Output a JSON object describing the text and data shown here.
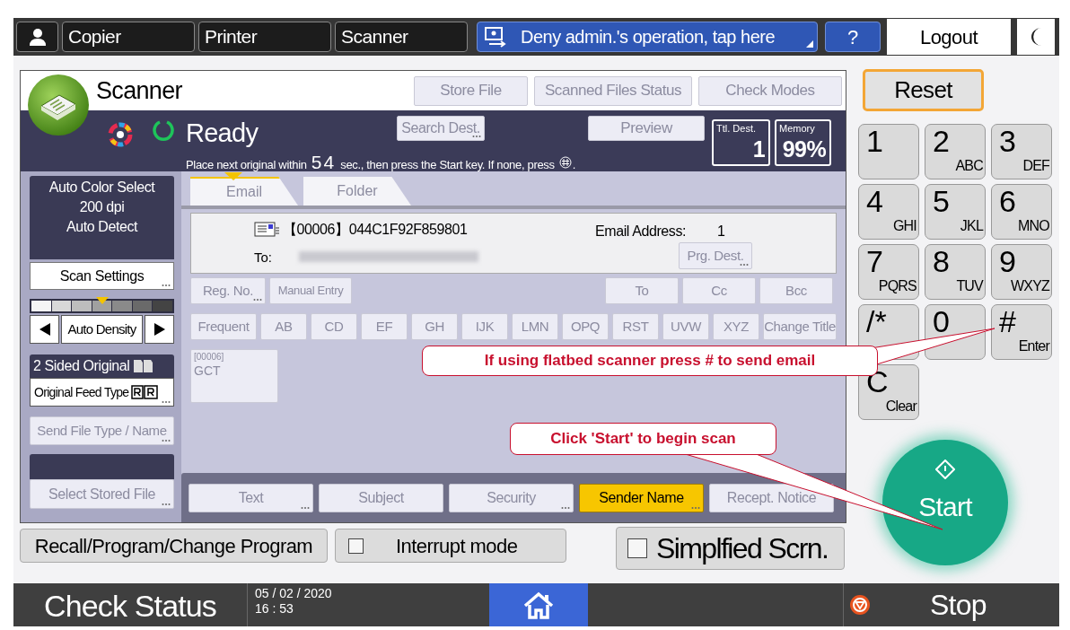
{
  "top_bar": {
    "apps": [
      {
        "label": "Copier",
        "selected": false
      },
      {
        "label": "Printer",
        "selected": false
      },
      {
        "label": "Scanner",
        "selected": false
      }
    ],
    "notice": "Deny admin.'s operation, tap here",
    "help": "?",
    "logout": "Logout"
  },
  "app": {
    "title": "Scanner",
    "header_buttons": [
      {
        "label": "Store File",
        "disabled": true
      },
      {
        "label": "Scanned Files Status",
        "disabled": true
      },
      {
        "label": "Check Modes",
        "disabled": true
      }
    ]
  },
  "status": {
    "text": "Ready",
    "message_before": "Place next original within",
    "seconds": "54",
    "message_after": "sec., then press the Start key. If none, press",
    "message_end": ".",
    "search_dest": {
      "label": "Search Dest.",
      "disabled": true
    },
    "preview": {
      "label": "Preview",
      "disabled": true
    },
    "total_dest": {
      "label": "Ttl. Dest.",
      "value": "1"
    },
    "memory": {
      "label": "Memory",
      "value": "99%"
    }
  },
  "settings_summary": [
    "Auto Color Select",
    "200 dpi",
    "Auto Detect"
  ],
  "scan_settings": "Scan Settings",
  "density": {
    "label": "Auto Density",
    "level": 0.5
  },
  "two_sided": "2 Sided Original",
  "feed_type": "Original Feed Type",
  "send_file_type": {
    "label": "Send File Type / Name",
    "disabled": true
  },
  "select_stored_file": {
    "label": "Select Stored File",
    "disabled": true
  },
  "tabs": [
    {
      "label": "Email",
      "selected": true
    },
    {
      "label": "Folder",
      "selected": false
    }
  ],
  "destination": {
    "entry": "【00006】044C1F92F859801",
    "to_label": "To:",
    "count_label": "Email Address:",
    "count": "1",
    "prg_dest": {
      "label": "Prg. Dest.",
      "disabled": true
    }
  },
  "dest_buttons": [
    {
      "label": "Reg. No.",
      "disabled": true
    },
    {
      "label": "Manual Entry",
      "disabled": true
    },
    {
      "label": "To",
      "disabled": true
    },
    {
      "label": "Cc",
      "disabled": true
    },
    {
      "label": "Bcc",
      "disabled": true
    }
  ],
  "index_buttons": [
    {
      "label": "Frequent",
      "disabled": true
    },
    {
      "label": "AB",
      "disabled": true
    },
    {
      "label": "CD",
      "disabled": true
    },
    {
      "label": "EF",
      "disabled": true
    },
    {
      "label": "GH",
      "disabled": true
    },
    {
      "label": "IJK",
      "disabled": true
    },
    {
      "label": "LMN",
      "disabled": true
    },
    {
      "label": "OPQ",
      "disabled": true
    },
    {
      "label": "RST",
      "disabled": true
    },
    {
      "label": "UVW",
      "disabled": true
    },
    {
      "label": "XYZ",
      "disabled": true
    },
    {
      "label": "Change Title",
      "disabled": true
    }
  ],
  "dest_tiles": [
    {
      "id": "[00006]",
      "name": "GCT",
      "disabled": true
    }
  ],
  "field_buttons": [
    {
      "label": "Text",
      "selected": false,
      "disabled": true
    },
    {
      "label": "Subject",
      "selected": false,
      "disabled": true
    },
    {
      "label": "Security",
      "selected": false,
      "disabled": true
    },
    {
      "label": "Sender Name",
      "selected": true,
      "disabled": false
    },
    {
      "label": "Recept. Notice",
      "selected": false,
      "disabled": true
    }
  ],
  "recall": "Recall/Program/Change Program",
  "interrupt": {
    "label": "Interrupt mode",
    "checked": false
  },
  "simplified": {
    "label": "Simplfied Scrn.",
    "checked": false
  },
  "keypad": {
    "reset": "Reset",
    "keys": [
      {
        "main": "1"
      },
      {
        "main": "2",
        "sub": "ABC"
      },
      {
        "main": "3",
        "sub": "DEF"
      },
      {
        "main": "4",
        "sub": "GHI"
      },
      {
        "main": "5",
        "sub": "JKL"
      },
      {
        "main": "6",
        "sub": "MNO"
      },
      {
        "main": "7",
        "sub": "PQRS"
      },
      {
        "main": "8",
        "sub": "TUV"
      },
      {
        "main": "9",
        "sub": "WXYZ"
      },
      {
        "main": "/*"
      },
      {
        "main": "0"
      },
      {
        "main": "#",
        "sub": "Enter"
      },
      {
        "main": "C",
        "sub": "Clear"
      }
    ]
  },
  "start": "Start",
  "status_bar": {
    "check_status": "Check Status",
    "date": "05 / 02 / 2020",
    "time": "16 : 53",
    "stop": "Stop"
  },
  "callouts": [
    {
      "text": "If using flatbed scanner press # to send email"
    },
    {
      "text": "Click 'Start' to begin scan"
    }
  ]
}
